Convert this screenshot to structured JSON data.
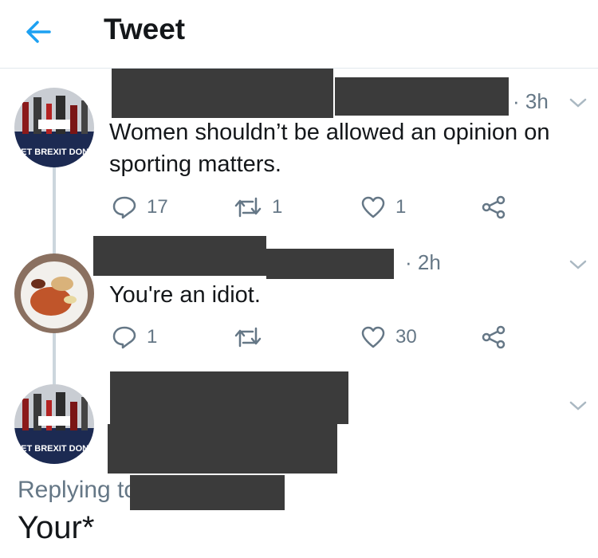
{
  "header": {
    "title": "Tweet",
    "back_icon": "arrow-left-icon",
    "accent_color": "#1da1f2"
  },
  "tweets": [
    {
      "time": "· 3h",
      "text_line1": "Women shouldn’t be allowed an opinion on",
      "text_line2": "sporting matters.",
      "reply_count": "17",
      "retweet_count": "1",
      "like_count": "1",
      "avatar_text": "GET BREXIT DONE"
    },
    {
      "time": "· 2h",
      "text_line1": "You're an idiot.",
      "reply_count": "1",
      "retweet_count": "",
      "like_count": "30"
    },
    {
      "avatar_text": "GET BREXIT DONE",
      "replying_to_label": "Replying to",
      "text": "Your*"
    }
  ],
  "icons": [
    "reply-icon",
    "retweet-icon",
    "like-icon",
    "share-icon",
    "chevron-down-icon"
  ],
  "colors": {
    "icon_gray": "#657786",
    "redaction": "#3b3b3b",
    "divider": "#e1e8ed"
  }
}
